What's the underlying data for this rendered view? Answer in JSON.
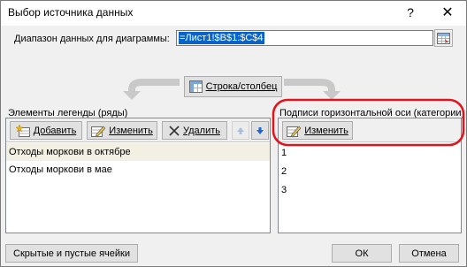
{
  "window": {
    "title": "Выбор источника данных",
    "help_glyph": "?",
    "close_glyph": "✕"
  },
  "range": {
    "label": "Диапазон данных для диаграммы:",
    "value": "=Лист1!$B$1:$C$4"
  },
  "switch_button": {
    "label": "Строка/столбец"
  },
  "legend": {
    "group_label": "Элементы легенды (ряды)",
    "add_label": "Добавить",
    "edit_label": "Изменить",
    "delete_label": "Удалить",
    "items": [
      "Отходы моркови в октябре",
      "Отходы моркови в мае"
    ]
  },
  "categories": {
    "group_label": "Подписи горизонтальной оси (категории)",
    "edit_label": "Изменить",
    "items": [
      "1",
      "2",
      "3"
    ]
  },
  "footer": {
    "hidden_cells_label": "Скрытые и пустые ячейки",
    "ok_label": "ОК",
    "cancel_label": "Отмена"
  },
  "colors": {
    "selection_highlight": "#f2efe3",
    "input_selection": "#0a64c8",
    "annotation_ellipse": "#e0141e",
    "move_arrow_blue": "#1e64d2"
  },
  "icons": {
    "add": "add-series-icon",
    "edit": "edit-icon",
    "delete": "delete-x-icon",
    "up": "move-up-icon",
    "down": "move-down-icon",
    "collapse": "collapse-range-icon"
  }
}
